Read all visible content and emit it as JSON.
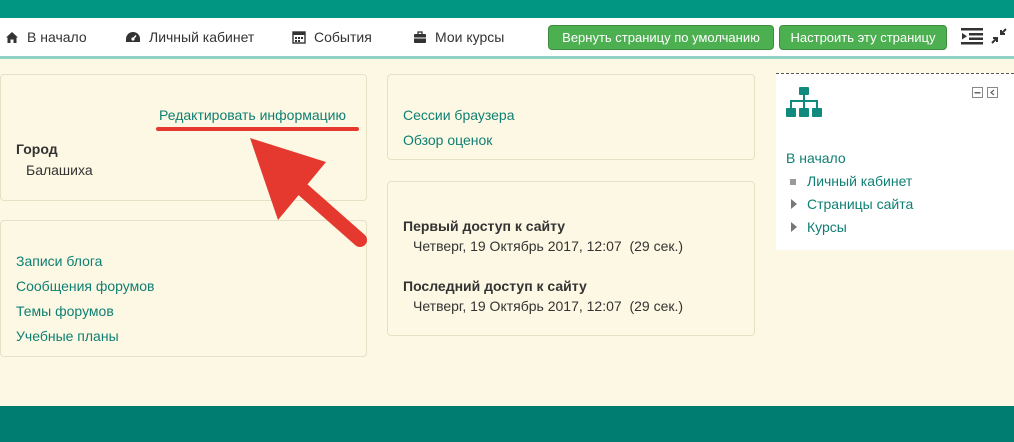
{
  "nav": {
    "home": "В начало",
    "dashboard": "Личный кабинет",
    "events": "События",
    "my_courses": "Мои курсы",
    "reset_button": "Вернуть страницу по умолчанию",
    "customize_button": "Настроить эту страницу"
  },
  "profile": {
    "edit_link": "Редактировать информацию",
    "city_label": "Город",
    "city_value": "Балашиха"
  },
  "links_card": {
    "items": [
      "Записи блога",
      "Сообщения форумов",
      "Темы форумов",
      "Учебные планы"
    ]
  },
  "reports_card": {
    "items": [
      "Сессии браузера",
      "Обзор оценок"
    ]
  },
  "access_card": {
    "first_label": "Первый доступ к сайту",
    "first_value": "Четверг, 19 Октябрь 2017, 12:07  (29 сек.)",
    "last_label": "Последний доступ к сайту",
    "last_value": "Четверг, 19 Октябрь 2017, 12:07  (29 сек.)"
  },
  "navigation_block": {
    "root": "В начало",
    "items": [
      "Личный кабинет",
      "Страницы сайта",
      "Курсы"
    ]
  },
  "colors": {
    "brand": "#009682",
    "button": "#4caf50",
    "link": "#0f7f73",
    "annotation": "#e53930"
  }
}
